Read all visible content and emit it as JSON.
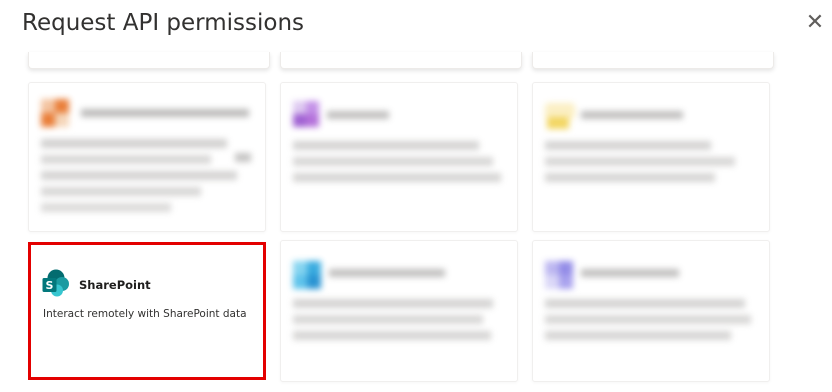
{
  "dialog": {
    "title": "Request API permissions",
    "close_icon": "close-icon",
    "close_glyph": "✕"
  },
  "cards": {
    "sharepoint": {
      "name": "SharePoint",
      "description": "Interact remotely with SharePoint data",
      "icon": "sharepoint-logo-icon"
    }
  },
  "colors": {
    "selection_border": "#e30000",
    "sharepoint_dark": "#036c70",
    "sharepoint_mid": "#1a9ba1",
    "sharepoint_light": "#37c6d0"
  }
}
